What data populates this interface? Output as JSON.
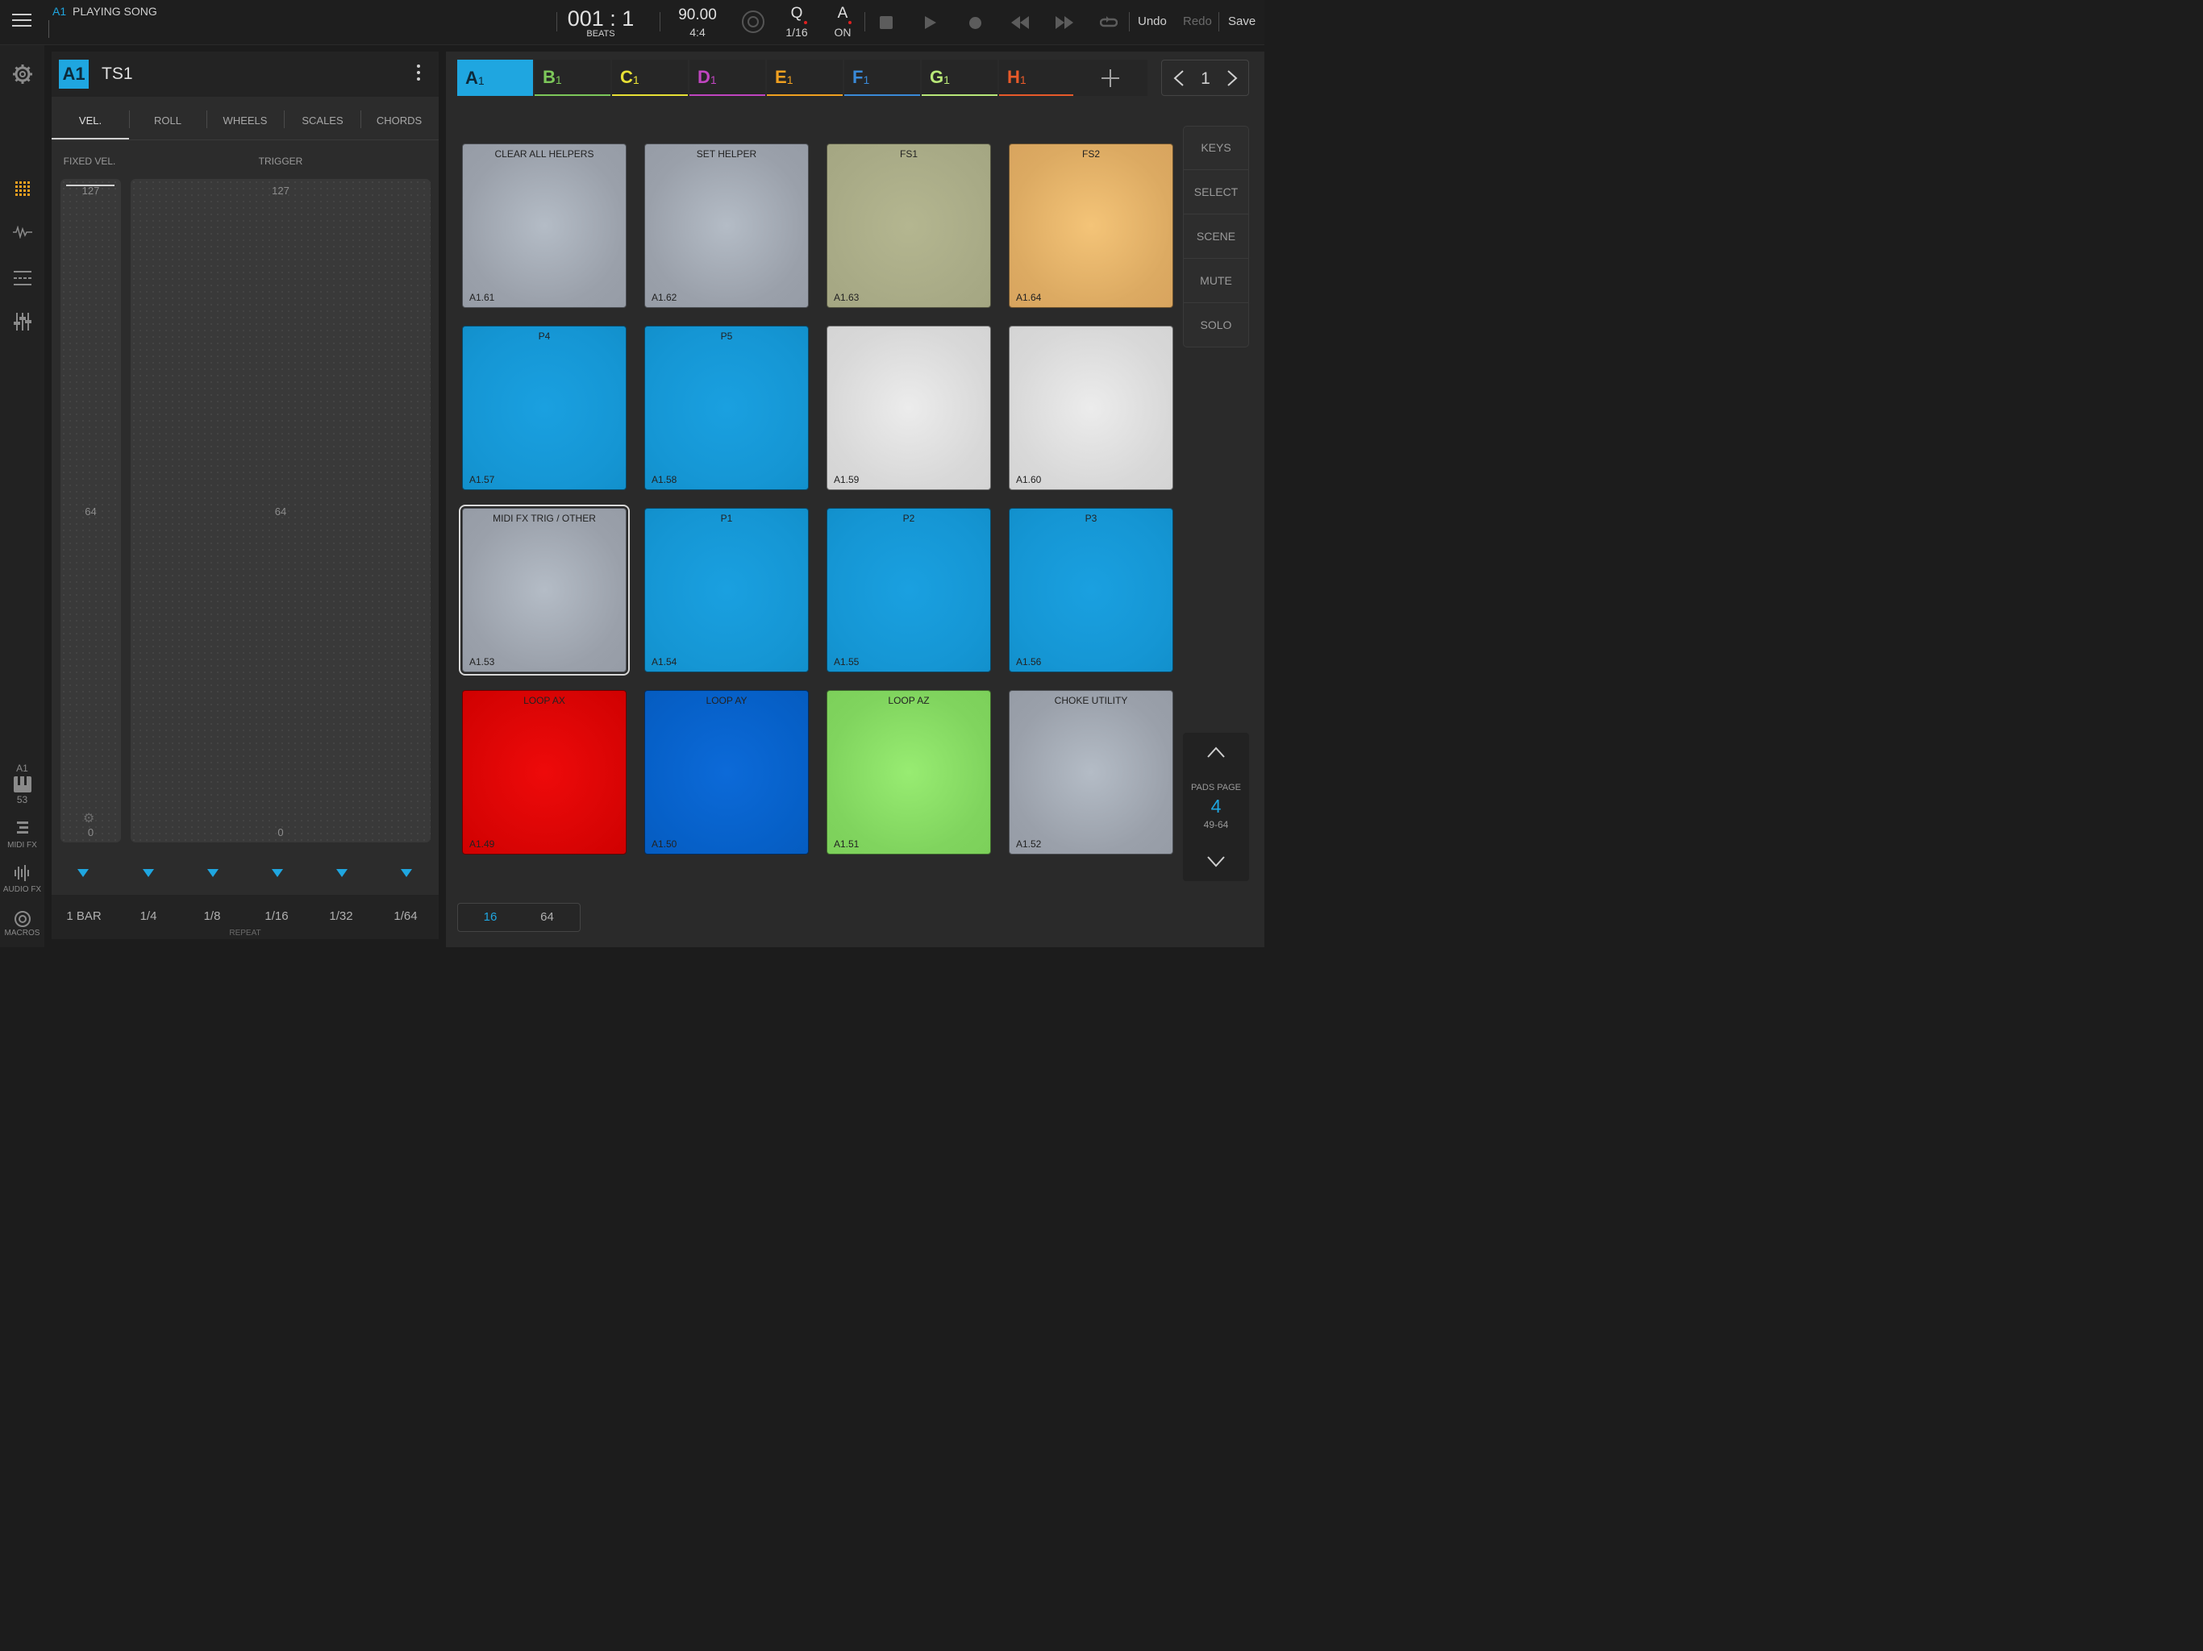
{
  "topbar": {
    "track_tag": "A1",
    "status": "PLAYING SONG",
    "position": "001 : 1",
    "position_unit": "BEATS",
    "tempo": "90.00",
    "time_signature": "4:4",
    "quantize_label": "Q",
    "quantize_value": "1/16",
    "auto_label": "A",
    "auto_value": "ON",
    "undo": "Undo",
    "redo": "Redo",
    "save": "Save"
  },
  "leftnav": {
    "track": "A1",
    "note": "53",
    "midi_fx": "MIDI FX",
    "audio_fx": "AUDIO FX",
    "macros": "MACROS"
  },
  "instrument": {
    "tag": "A1",
    "name": "TS1"
  },
  "perf_tabs": [
    "VEL.",
    "ROLL",
    "WHEELS",
    "SCALES",
    "CHORDS"
  ],
  "velocity": {
    "fixed_label": "FIXED VEL.",
    "trigger_label": "TRIGGER",
    "max": "127",
    "mid": "64",
    "min": "0"
  },
  "repeat": {
    "rates": [
      "1 BAR",
      "1/4",
      "1/8",
      "1/16",
      "1/32",
      "1/64"
    ],
    "label": "REPEAT"
  },
  "tracks": [
    {
      "letter": "A",
      "num": "1",
      "color": "#1fa6e0"
    },
    {
      "letter": "B",
      "num": "1",
      "color": "#7dc85a"
    },
    {
      "letter": "C",
      "num": "1",
      "color": "#e8e035"
    },
    {
      "letter": "D",
      "num": "1",
      "color": "#c045c0"
    },
    {
      "letter": "E",
      "num": "1",
      "color": "#f0a020"
    },
    {
      "letter": "F",
      "num": "1",
      "color": "#3a8ad8"
    },
    {
      "letter": "G",
      "num": "1",
      "color": "#b8e878"
    },
    {
      "letter": "H",
      "num": "1",
      "color": "#e85a2a"
    }
  ],
  "bank_page": "1",
  "side_buttons": [
    "KEYS",
    "SELECT",
    "SCENE",
    "MUTE",
    "SOLO"
  ],
  "pads": [
    {
      "label": "CLEAR ALL HELPERS",
      "id": "A1.61",
      "color": "grey"
    },
    {
      "label": "SET HELPER",
      "id": "A1.62",
      "color": "grey"
    },
    {
      "label": "FS1",
      "id": "A1.63",
      "color": "olive"
    },
    {
      "label": "FS2",
      "id": "A1.64",
      "color": "orange"
    },
    {
      "label": "P4",
      "id": "A1.57",
      "color": "blue"
    },
    {
      "label": "P5",
      "id": "A1.58",
      "color": "blue"
    },
    {
      "label": "",
      "id": "A1.59",
      "color": "white"
    },
    {
      "label": "",
      "id": "A1.60",
      "color": "white"
    },
    {
      "label": "MIDI FX TRIG / OTHER",
      "id": "A1.53",
      "color": "grey"
    },
    {
      "label": "P1",
      "id": "A1.54",
      "color": "blue"
    },
    {
      "label": "P2",
      "id": "A1.55",
      "color": "blue"
    },
    {
      "label": "P3",
      "id": "A1.56",
      "color": "blue"
    },
    {
      "label": "LOOP AX",
      "id": "A1.49",
      "color": "red"
    },
    {
      "label": "LOOP AY",
      "id": "A1.50",
      "color": "darkblue"
    },
    {
      "label": "LOOP AZ",
      "id": "A1.51",
      "color": "green"
    },
    {
      "label": "CHOKE UTILITY",
      "id": "A1.52",
      "color": "grey"
    }
  ],
  "pads_page": {
    "label": "PADS PAGE",
    "number": "4",
    "range": "49-64"
  },
  "pad_mode": {
    "option_16": "16",
    "option_64": "64"
  }
}
